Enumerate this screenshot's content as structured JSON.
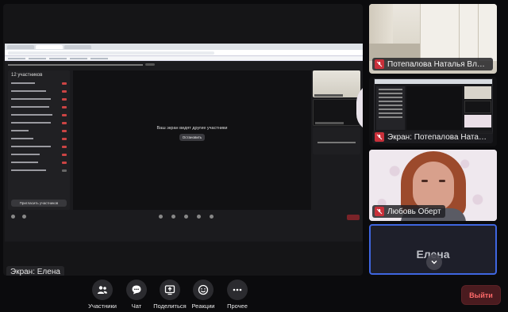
{
  "main": {
    "label": "Экран: Елена",
    "shared_screen": {
      "participants_title": "12 участников",
      "stage_message": "Ваш экран видят другие участники",
      "stop_button": "Остановить",
      "add_participant_button": "Пригласить участников"
    }
  },
  "tiles": [
    {
      "name": "Потепалова Наталья Влади...",
      "muted": true,
      "kind": "room"
    },
    {
      "name": "Экран: Потепалова Наталь...",
      "muted": true,
      "kind": "screen"
    },
    {
      "name": "Любовь Оберт",
      "muted": true,
      "kind": "person"
    },
    {
      "name": "Елена",
      "muted": false,
      "kind": "avatar",
      "active_speaker": true
    }
  ],
  "toolbar": {
    "participants_label": "Участники",
    "chat_label": "Чат",
    "share_label": "Поделиться",
    "reactions_label": "Реакции",
    "more_label": "Прочее",
    "leave_label": "Выйти"
  },
  "icons": {
    "participants": "people-icon",
    "chat": "chat-bubble-icon",
    "share": "share-screen-icon",
    "reactions": "smiley-icon",
    "more": "more-dots-icon",
    "muted": "mic-off-icon",
    "scroll": "chevron-down-icon"
  },
  "colors": {
    "background": "#0b0b0d",
    "muted_badge": "#c9303a",
    "active_border": "#3f66e0",
    "leave_text": "#ff6a6a",
    "leave_bg": "#4a1b1f"
  }
}
